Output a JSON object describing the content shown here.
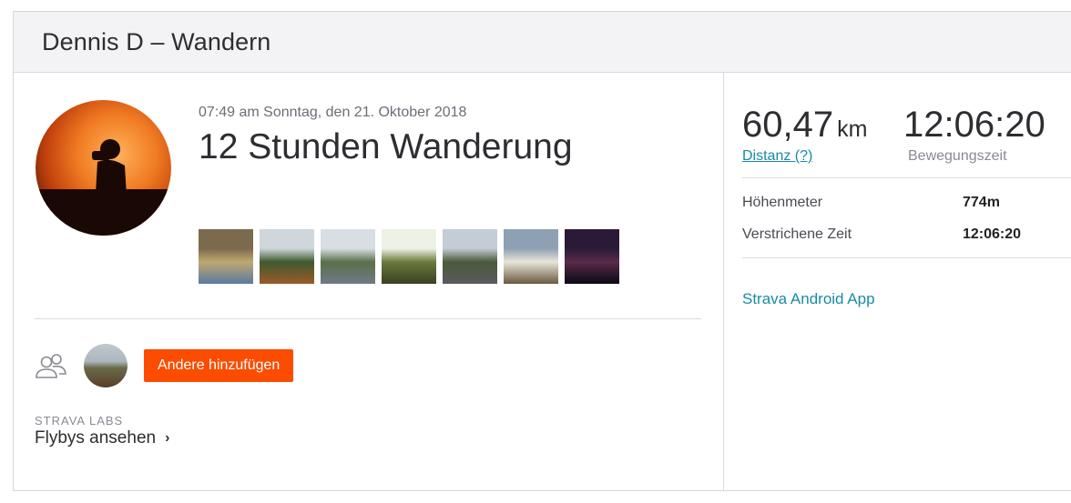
{
  "header": {
    "title": "Dennis D – Wandern"
  },
  "activity": {
    "date": "07:49 am Sonntag, den 21. Oktober 2018",
    "title": "12 Stunden Wanderung"
  },
  "photos": [
    {
      "name": "photo-1",
      "colors": [
        "#7c6a4e",
        "#bfa870",
        "#5a7aa0"
      ]
    },
    {
      "name": "photo-2",
      "colors": [
        "#cfd6dc",
        "#3f5a2e",
        "#9c5a2a"
      ]
    },
    {
      "name": "photo-3",
      "colors": [
        "#d8dee4",
        "#5b6f4a",
        "#6e7a86"
      ]
    },
    {
      "name": "photo-4",
      "colors": [
        "#eef2e6",
        "#6a7a3c",
        "#3a3f22"
      ]
    },
    {
      "name": "photo-5",
      "colors": [
        "#c4ccd6",
        "#4a5a3a",
        "#5a5a60"
      ]
    },
    {
      "name": "photo-6",
      "colors": [
        "#8ea0b4",
        "#e8e4d8",
        "#6a5a40"
      ]
    },
    {
      "name": "photo-7",
      "colors": [
        "#2a1a38",
        "#5a2a4a",
        "#0a0a14"
      ]
    }
  ],
  "social": {
    "add_button": "Andere hinzufügen"
  },
  "labs": {
    "label": "STRAVA LABS",
    "flybys": "Flybys ansehen"
  },
  "stats": {
    "distance": {
      "value": "60,47",
      "unit": "km",
      "label": "Distanz (?)"
    },
    "moving_time": {
      "value": "12:06:20",
      "label": "Bewegungszeit"
    },
    "rows": [
      {
        "label": "Höhenmeter",
        "value": "774m"
      },
      {
        "label": "Verstrichene Zeit",
        "value": "12:06:20"
      }
    ],
    "device": "Strava Android App"
  },
  "colors": {
    "accent": "#fc4c02",
    "link": "#1a8aa8"
  },
  "icons": [
    "people-icon",
    "chevron-right-icon"
  ]
}
